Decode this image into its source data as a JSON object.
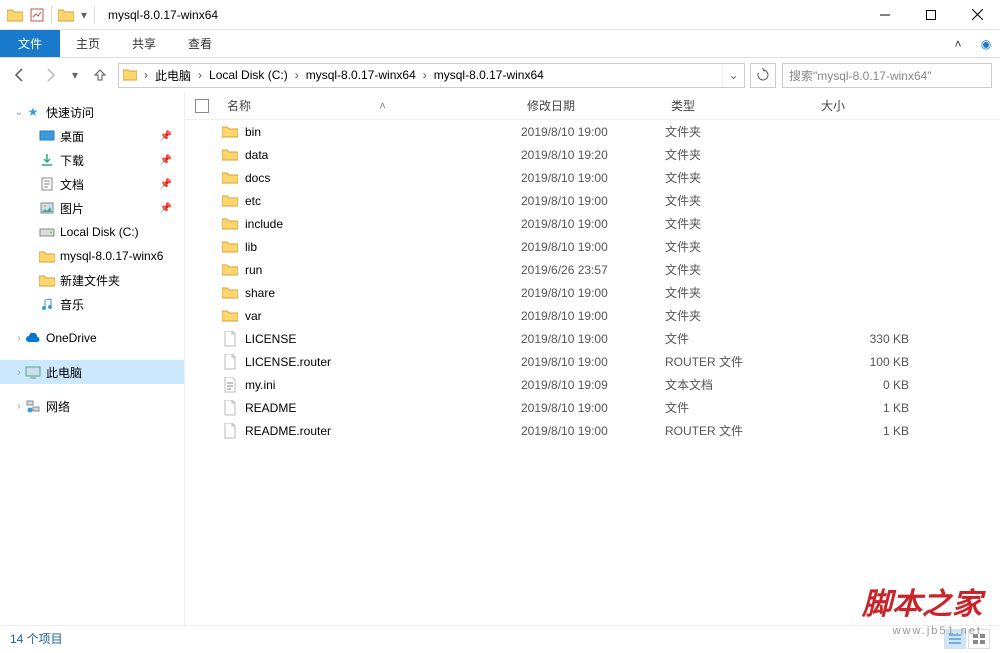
{
  "window": {
    "title": "mysql-8.0.17-winx64"
  },
  "ribbon": {
    "file": "文件",
    "tabs": [
      "主页",
      "共享",
      "查看"
    ]
  },
  "breadcrumb": {
    "segments": [
      "此电脑",
      "Local Disk (C:)",
      "mysql-8.0.17-winx64",
      "mysql-8.0.17-winx64"
    ]
  },
  "search": {
    "placeholder": "搜索\"mysql-8.0.17-winx64\""
  },
  "sidebar": {
    "quick": {
      "label": "快速访问",
      "items": [
        {
          "label": "桌面",
          "pinned": true
        },
        {
          "label": "下载",
          "pinned": true
        },
        {
          "label": "文档",
          "pinned": true
        },
        {
          "label": "图片",
          "pinned": true
        },
        {
          "label": "Local Disk (C:)",
          "pinned": false
        },
        {
          "label": "mysql-8.0.17-winx6",
          "pinned": false
        },
        {
          "label": "新建文件夹",
          "pinned": false
        },
        {
          "label": "音乐",
          "pinned": false
        }
      ]
    },
    "onedrive": "OneDrive",
    "thispc": "此电脑",
    "network": "网络"
  },
  "columns": {
    "name": "名称",
    "date": "修改日期",
    "type": "类型",
    "size": "大小"
  },
  "items": [
    {
      "kind": "folder",
      "name": "bin",
      "date": "2019/8/10 19:00",
      "type": "文件夹",
      "size": ""
    },
    {
      "kind": "folder",
      "name": "data",
      "date": "2019/8/10 19:20",
      "type": "文件夹",
      "size": ""
    },
    {
      "kind": "folder",
      "name": "docs",
      "date": "2019/8/10 19:00",
      "type": "文件夹",
      "size": ""
    },
    {
      "kind": "folder",
      "name": "etc",
      "date": "2019/8/10 19:00",
      "type": "文件夹",
      "size": ""
    },
    {
      "kind": "folder",
      "name": "include",
      "date": "2019/8/10 19:00",
      "type": "文件夹",
      "size": ""
    },
    {
      "kind": "folder",
      "name": "lib",
      "date": "2019/8/10 19:00",
      "type": "文件夹",
      "size": ""
    },
    {
      "kind": "folder",
      "name": "run",
      "date": "2019/6/26 23:57",
      "type": "文件夹",
      "size": ""
    },
    {
      "kind": "folder",
      "name": "share",
      "date": "2019/8/10 19:00",
      "type": "文件夹",
      "size": ""
    },
    {
      "kind": "folder",
      "name": "var",
      "date": "2019/8/10 19:00",
      "type": "文件夹",
      "size": ""
    },
    {
      "kind": "file",
      "name": "LICENSE",
      "date": "2019/8/10 19:00",
      "type": "文件",
      "size": "330 KB"
    },
    {
      "kind": "file",
      "name": "LICENSE.router",
      "date": "2019/8/10 19:00",
      "type": "ROUTER 文件",
      "size": "100 KB"
    },
    {
      "kind": "ini",
      "name": "my.ini",
      "date": "2019/8/10 19:09",
      "type": "文本文档",
      "size": "0 KB"
    },
    {
      "kind": "file",
      "name": "README",
      "date": "2019/8/10 19:00",
      "type": "文件",
      "size": "1 KB"
    },
    {
      "kind": "file",
      "name": "README.router",
      "date": "2019/8/10 19:00",
      "type": "ROUTER 文件",
      "size": "1 KB"
    }
  ],
  "status": {
    "count": "14 个项目"
  },
  "watermark": {
    "text": "脚本之家",
    "url": "www.jb51.net"
  }
}
